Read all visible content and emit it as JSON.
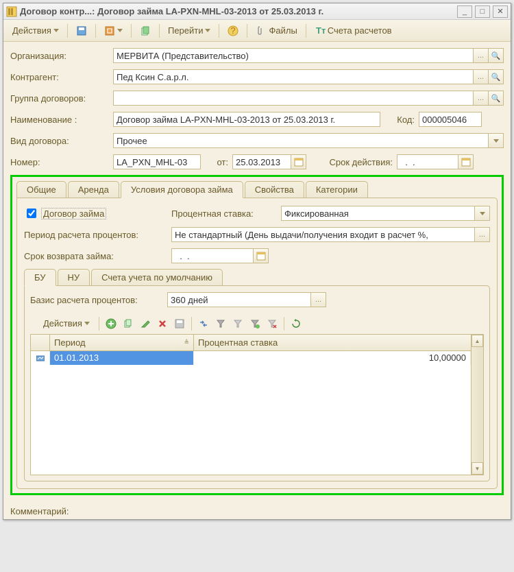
{
  "window": {
    "title": "Договор контр...: Договор займа LA-PXN-MHL-03-2013 от 25.03.2013 г."
  },
  "toolbar": {
    "actions": "Действия",
    "go_to": "Перейти",
    "files": "Файлы",
    "accounts": "Счета расчетов"
  },
  "form": {
    "org_label": "Организация:",
    "org_value": "МЕРВИТА (Представительство)",
    "counterparty_label": "Контрагент:",
    "counterparty_value": "Пед Ксин С.а.р.л.",
    "group_label": "Группа договоров:",
    "group_value": "",
    "name_label": "Наименование :",
    "name_value": "Договор займа LA-PXN-MHL-03-2013 от 25.03.2013 г.",
    "code_label": "Код:",
    "code_value": "000005046",
    "type_label": "Вид договора:",
    "type_value": "Прочее",
    "number_label": "Номер:",
    "number_value": "LA_PXN_MHL-03",
    "from_label": "от:",
    "from_value": "25.03.2013",
    "validity_label": "Срок действия:",
    "validity_value": "  .  .    "
  },
  "tabs": {
    "general": "Общие",
    "lease": "Аренда",
    "loan_terms": "Условия договора займа",
    "properties": "Свойства",
    "categories": "Категории"
  },
  "loan": {
    "checkbox_label": "Договор займа",
    "rate_label": "Процентная ставка:",
    "rate_value": "Фиксированная",
    "period_label": "Период расчета процентов:",
    "period_value": "Не стандартный (День выдачи/получения входит в расчет %,",
    "return_label": "Срок возврата займа:",
    "return_value": "  .  .    "
  },
  "subtabs": {
    "bu": "БУ",
    "nu": "НУ",
    "default": "Счета учета по умолчанию"
  },
  "basis": {
    "label": "Базис расчета процентов:",
    "value": "360 дней"
  },
  "grid_toolbar": {
    "actions": "Действия"
  },
  "grid": {
    "col_period": "Период",
    "col_rate": "Процентная ставка",
    "row1_date": "01.01.2013",
    "row1_rate": "10,00000"
  },
  "comment": {
    "label": "Комментарий:"
  }
}
